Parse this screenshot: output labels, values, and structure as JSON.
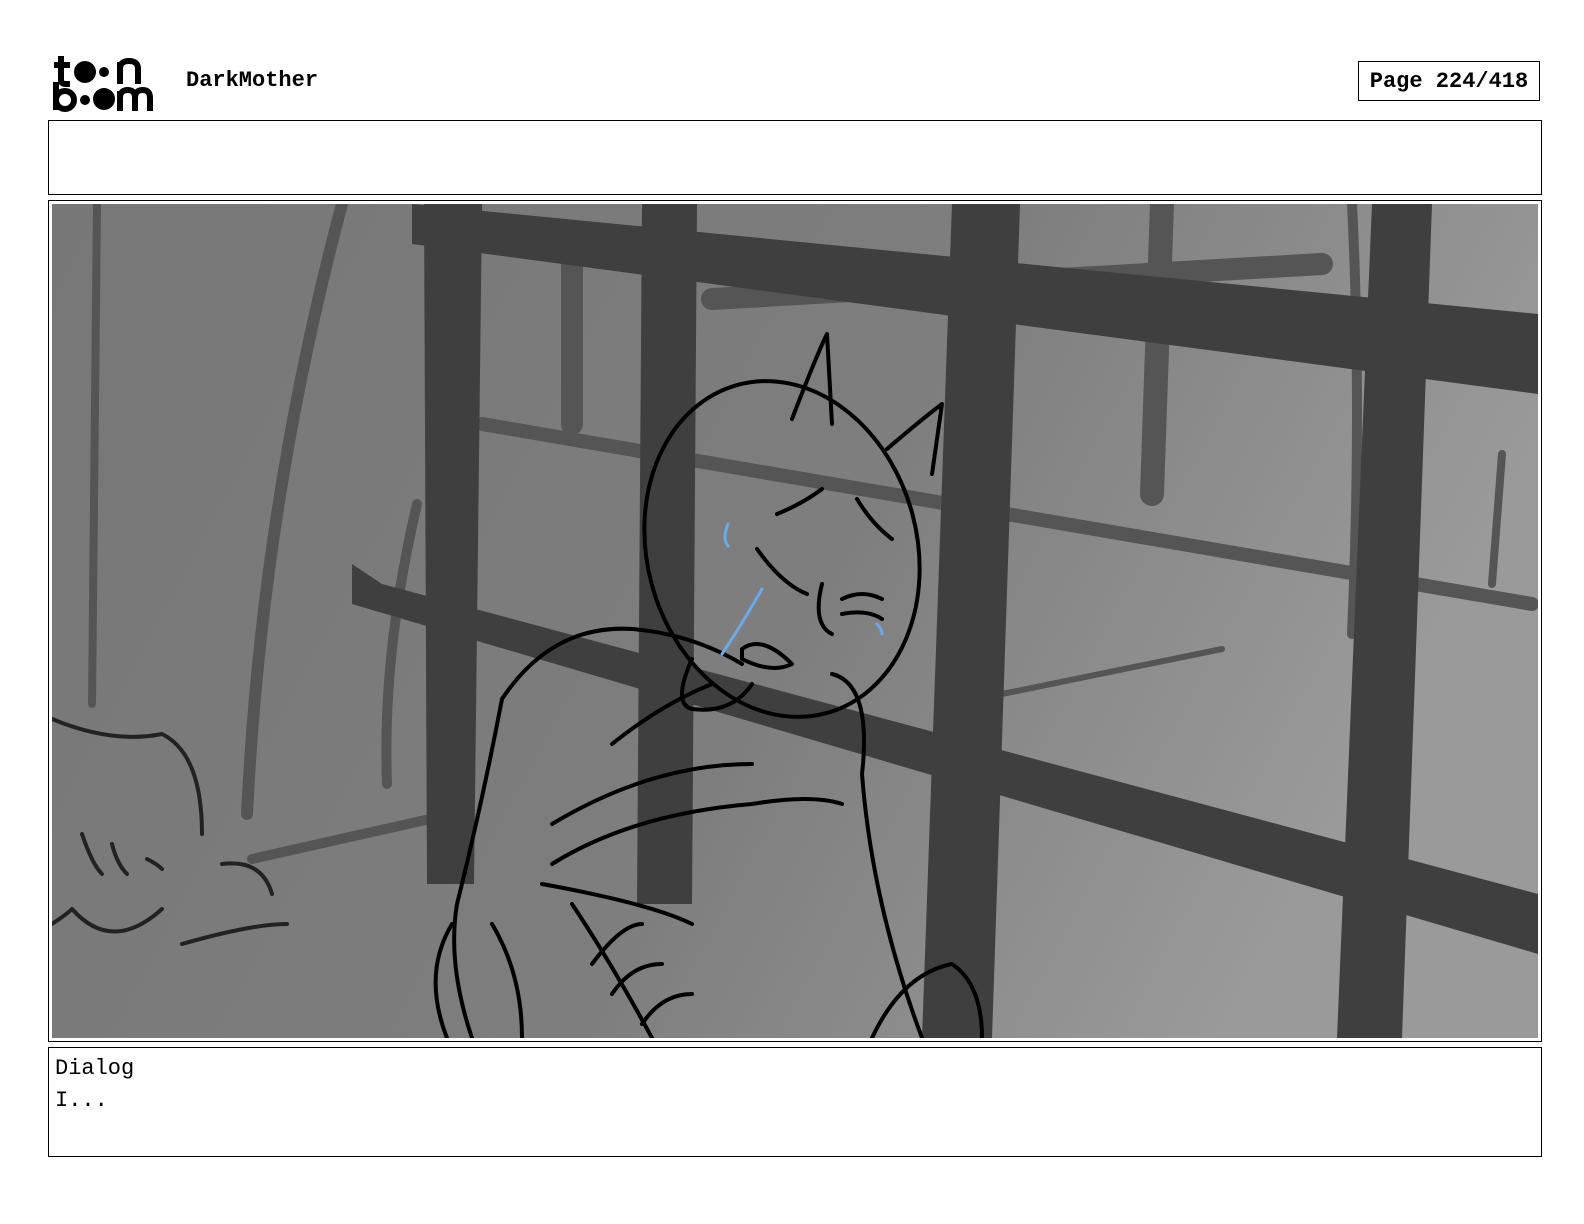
{
  "header": {
    "logo": {
      "text_line1": "toon",
      "text_line2": "boom"
    },
    "project_title": "DarkMother",
    "page_counter": "Page 224/418"
  },
  "notes": "",
  "panel": {
    "image_semantic": "storyboard-sketch",
    "colors": {
      "background": "#7d7d7d",
      "bars": "#3f3f3f",
      "line": "#000000",
      "tears": "#6fa8e8"
    }
  },
  "dialog": {
    "heading": "Dialog",
    "text": "I..."
  }
}
